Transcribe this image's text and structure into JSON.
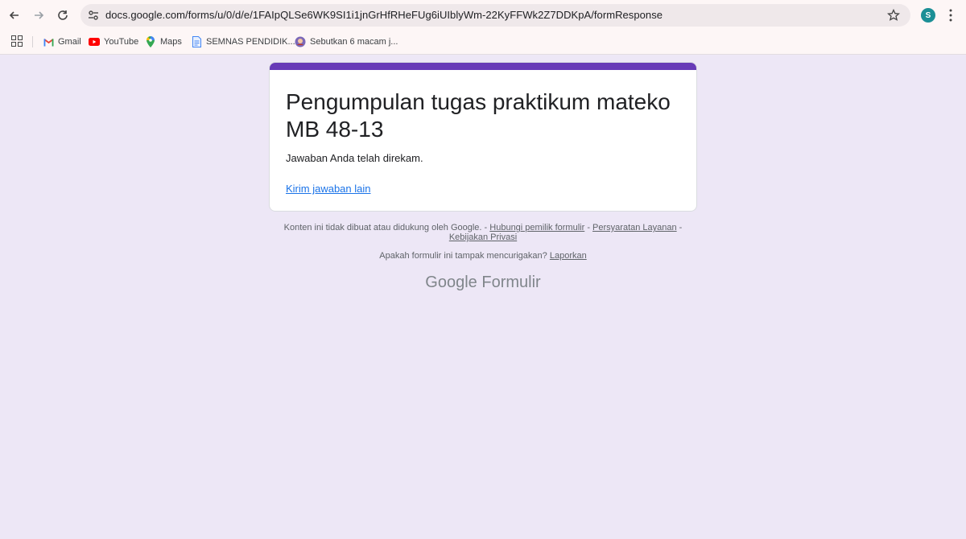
{
  "browser": {
    "url": "docs.google.com/forms/u/0/d/e/1FAIpQLSe6WK9SI1i1jnGrHfRHeFUg6iUIblyWm-22KyFFWk2Z7DDKpA/formResponse",
    "profile_initial": "S"
  },
  "bookmarks": [
    {
      "label": "Gmail",
      "icon": "gmail-icon"
    },
    {
      "label": "YouTube",
      "icon": "youtube-icon"
    },
    {
      "label": "Maps",
      "icon": "maps-icon"
    },
    {
      "label": "SEMNAS PENDIDIK...",
      "icon": "doc-icon"
    },
    {
      "label": "Sebutkan 6 macam j...",
      "icon": "site-icon"
    }
  ],
  "form": {
    "title": "Pengumpulan tugas praktikum mateko MB 48-13",
    "confirmation": "Jawaban Anda telah direkam.",
    "submit_another": "Kirim jawaban lain",
    "accent_color": "#673ab7"
  },
  "footer": {
    "disclaimer": "Konten ini tidak dibuat atau didukung oleh Google.",
    "contact_owner": "Hubungi pemilik formulir",
    "terms": "Persyaratan Layanan",
    "privacy": "Kebijakan Privasi",
    "suspicious_question": "Apakah formulir ini tampak mencurigakan?",
    "report": "Laporkan",
    "brand_google": "Google",
    "brand_forms": "Formulir"
  }
}
